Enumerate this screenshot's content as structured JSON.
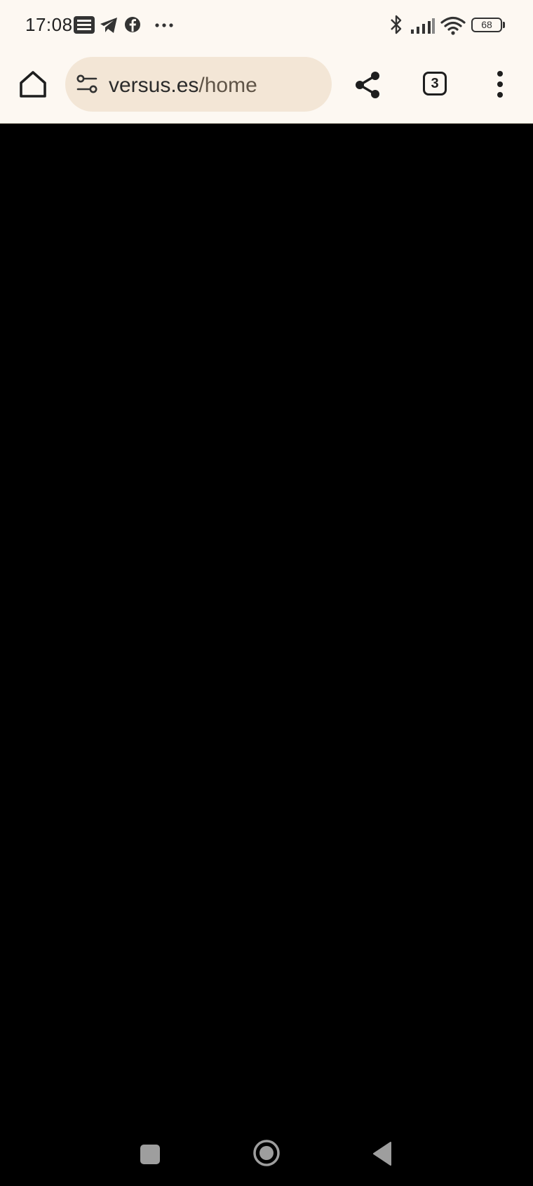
{
  "status_bar": {
    "time": "17:08",
    "notification_icons": [
      "news-icon",
      "telegram-icon",
      "facebook-icon",
      "more-dots-icon"
    ],
    "system_icons": [
      "bluetooth-icon",
      "signal-icon",
      "wifi-icon",
      "battery-icon"
    ],
    "battery_level": "68"
  },
  "browser": {
    "url_domain": "versus.es",
    "url_path": "/home",
    "tab_count": "3",
    "buttons": [
      "home-icon",
      "site-settings-icon",
      "share-icon",
      "tabs-icon",
      "more-vert-icon"
    ]
  },
  "navigation_bar": {
    "buttons": [
      "recents-square-icon",
      "home-circle-icon",
      "back-triangle-icon"
    ]
  },
  "colors": {
    "toolbar_bg": "#fdf8f2",
    "urlbar_bg": "#f3e6d6",
    "content_bg": "#000000"
  }
}
